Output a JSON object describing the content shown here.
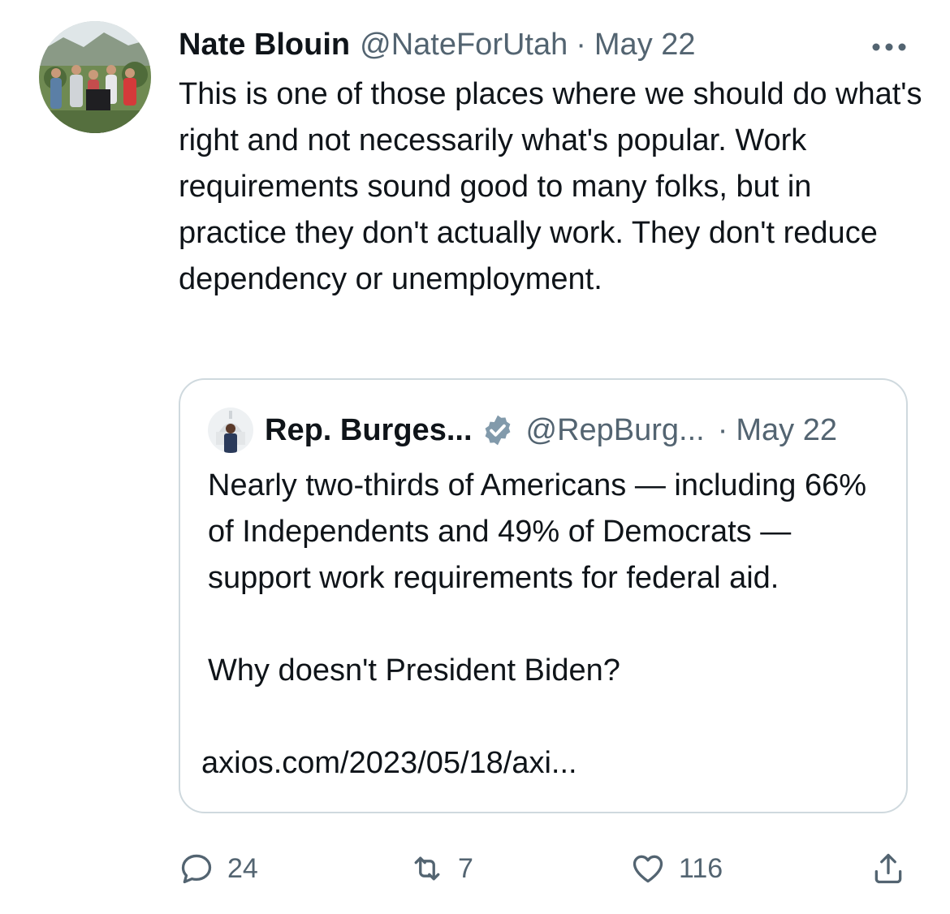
{
  "tweet": {
    "author_name": "Nate Blouin",
    "handle": "@NateForUtah",
    "separator": "·",
    "date": "May 22",
    "text": "This is one of those places where we should do what's right and not necessarily what's popular. Work requirements sound good to many folks, but in practice they don't actually work. They don't reduce dependency or unemployment."
  },
  "quoted": {
    "author_name": "Rep. Burges...",
    "handle": "@RepBurg...",
    "separator": "·",
    "date": "May 22",
    "text_paragraph_1": "Nearly two-thirds of Americans — including 66% of Independents and 49% of Democrats — support work requirements for federal aid.",
    "text_paragraph_2": "Why doesn't President Biden?",
    "link": "axios.com/2023/05/18/axi..."
  },
  "actions": {
    "replies": "24",
    "retweets": "7",
    "likes": "116"
  },
  "colors": {
    "text": "#0f1419",
    "secondary": "#536471",
    "border": "#cfd9de",
    "verified_badge": "#829aab"
  }
}
